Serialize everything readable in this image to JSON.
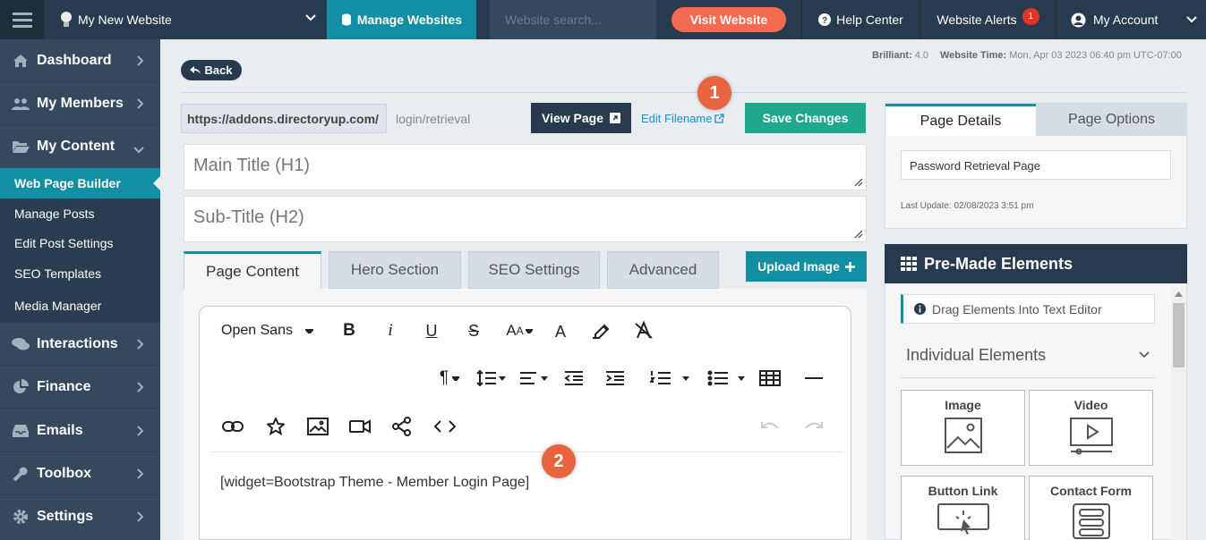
{
  "topbar": {
    "site_name": "My New Website",
    "manage_label": "Manage Websites",
    "search_placeholder": "Website search...",
    "visit_label": "Visit Website",
    "help_label": "Help Center",
    "alerts_label": "Website Alerts",
    "alerts_count": "1",
    "account_label": "My Account"
  },
  "sidebar": {
    "items": [
      {
        "label": "Dashboard",
        "icon": "home-icon"
      },
      {
        "label": "My Members",
        "icon": "users-icon"
      },
      {
        "label": "My Content",
        "icon": "folder-open-icon"
      },
      {
        "label": "Interactions",
        "icon": "comments-icon"
      },
      {
        "label": "Finance",
        "icon": "pie-chart-icon"
      },
      {
        "label": "Emails",
        "icon": "inbox-icon"
      },
      {
        "label": "Toolbox",
        "icon": "wrench-icon"
      },
      {
        "label": "Settings",
        "icon": "gear-icon"
      }
    ],
    "subitems": [
      "Web Page Builder",
      "Manage Posts",
      "Edit Post Settings",
      "SEO Templates",
      "Media Manager"
    ]
  },
  "header": {
    "back_label": "Back",
    "version_label": "Brilliant:",
    "version_value": "4.0",
    "time_label": "Website Time:",
    "time_value": "Mon, Apr 03 2023 06:40 pm UTC-07:00"
  },
  "page": {
    "url_base": "https://addons.directoryup.com/",
    "url_path": "login/retrieval",
    "view_page_label": "View Page",
    "edit_filename_label": "Edit Filename",
    "save_label": "Save Changes",
    "main_title_placeholder": "Main Title (H1)",
    "subtitle_placeholder": "Sub-Title (H2)"
  },
  "tabs": [
    "Page Content",
    "Hero Section",
    "SEO Settings",
    "Advanced"
  ],
  "upload_label": "Upload Image",
  "editor": {
    "font_name": "Open Sans",
    "content": "[widget=Bootstrap Theme - Member Login Page]"
  },
  "callouts": [
    "1",
    "2"
  ],
  "details": {
    "tab_details": "Page Details",
    "tab_options": "Page Options",
    "page_name": "Password Retrieval Page",
    "last_update": "Last Update: 02/08/2023 3:51 pm"
  },
  "premade": {
    "title": "Pre-Made Elements",
    "hint": "Drag Elements Into Text Editor",
    "section": "Individual Elements",
    "elements": [
      "Image",
      "Video",
      "Button Link",
      "Contact Form"
    ]
  },
  "colors": {
    "teal": "#138fa3",
    "navy": "#283b4e",
    "green": "#1fa88e",
    "orange": "#f26b50"
  }
}
